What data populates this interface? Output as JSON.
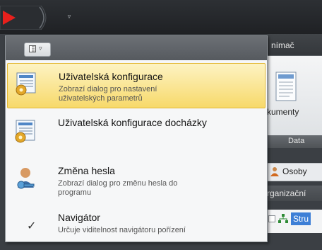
{
  "ribbon": {
    "tab_label": "nímač",
    "button_label": "kumenty",
    "group_label": "Data",
    "osoby_label": "Osoby",
    "org_label": "rganizační",
    "tree_label": "Stru"
  },
  "menu": {
    "items": [
      {
        "title": "Uživatelská konfigurace",
        "desc_line1": "Zobrazí dialog pro nastavení",
        "desc_line2": "uživatelských parametrů",
        "icon": "gear-document-icon"
      },
      {
        "title": "Uživatelská konfigurace docházky",
        "desc_line1": "",
        "desc_line2": "",
        "icon": "gear-document-icon"
      },
      {
        "title": "Změna hesla",
        "desc_line1": "Zobrazí dialog pro změnu hesla do",
        "desc_line2": "programu",
        "icon": "user-key-icon"
      },
      {
        "title": "Navigátor",
        "desc_line1": "Určuje viditelnost navigátoru pořízení",
        "desc_line2": "",
        "icon": "check-icon"
      }
    ]
  },
  "colors": {
    "highlight_top": "#fdf3c3",
    "highlight_bottom": "#f7d96a",
    "orb_red": "#e8201c"
  }
}
